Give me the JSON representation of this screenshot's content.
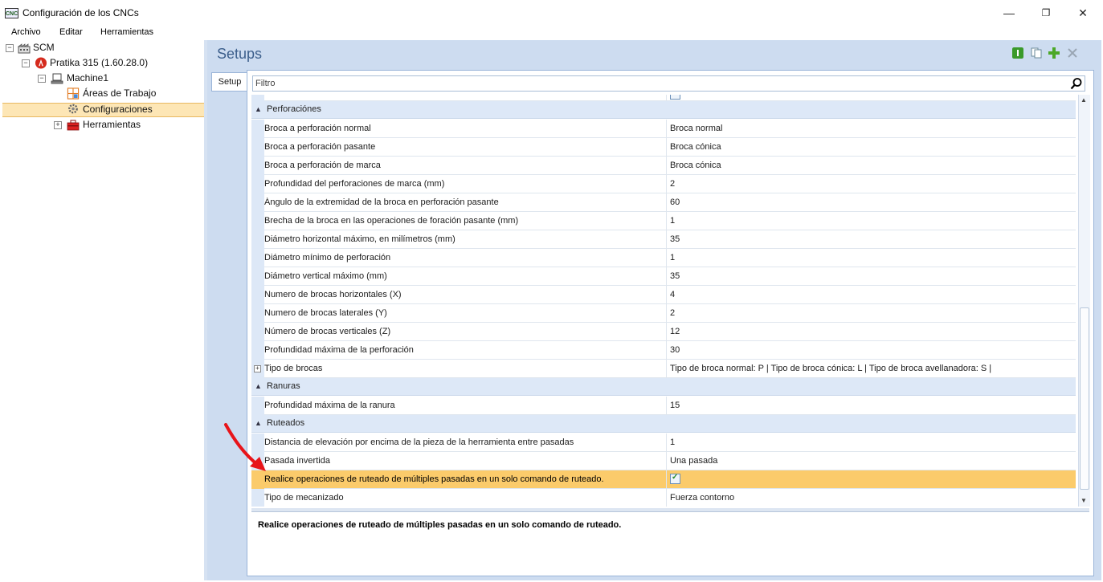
{
  "window": {
    "title": "Configuración de los CNCs",
    "app_icon_text": "CNC",
    "minimize": "—",
    "maximize": "❐",
    "close": "✕"
  },
  "menu": [
    "Archivo",
    "Editar",
    "Herramientas"
  ],
  "tree": {
    "root": "SCM",
    "machine_ver": "Pratika 315 (1.60.28.0)",
    "machine": "Machine1",
    "work_areas": "Áreas de Trabajo",
    "configs": "Configuraciones",
    "tools": "Herramientas"
  },
  "panel": {
    "title": "Setups",
    "tab": "Setup",
    "filter_placeholder": "Filtro"
  },
  "grid": {
    "categories": {
      "perforaciones": "Perforaciónes",
      "ranuras": "Ranuras",
      "ruteados": "Ruteados"
    },
    "perforaciones": [
      {
        "name": "Broca a perforación normal",
        "value": "Broca normal"
      },
      {
        "name": "Broca a perforación pasante",
        "value": "Broca cónica"
      },
      {
        "name": "Broca a perforación de marca",
        "value": "Broca cónica"
      },
      {
        "name": "Profundidad del perforaciones de marca (mm)",
        "value": "2"
      },
      {
        "name": "Ángulo de la extremidad de la broca en perforación pasante",
        "value": "60"
      },
      {
        "name": "Brecha de la broca en las operaciones de foración pasante (mm)",
        "value": "1"
      },
      {
        "name": "Diámetro horizontal máximo, en milímetros (mm)",
        "value": "35"
      },
      {
        "name": "Diámetro mínimo de perforación",
        "value": "1"
      },
      {
        "name": "Diámetro vertical máximo (mm)",
        "value": "35"
      },
      {
        "name": "Numero de brocas horizontales (X)",
        "value": "4"
      },
      {
        "name": "Numero de brocas laterales (Y)",
        "value": "2"
      },
      {
        "name": "Número de brocas verticales (Z)",
        "value": "12"
      },
      {
        "name": "Profundidad máxima de la perforación",
        "value": "30"
      },
      {
        "name": "Tipo de brocas",
        "value": "Tipo de broca normal: P  |  Tipo de broca cónica: L  |  Tipo de broca avellanadora: S  |"
      }
    ],
    "ranuras": [
      {
        "name": "Profundidad máxima de la ranura",
        "value": "15"
      }
    ],
    "ruteados": [
      {
        "name": "Distancia de elevación por encima de la pieza de la herramienta entre pasadas",
        "value": "1"
      },
      {
        "name": "Pasada invertida",
        "value": "Una pasada"
      },
      {
        "name": "Realice operaciones de ruteado de múltiples pasadas en un solo comando de ruteado.",
        "value": ""
      },
      {
        "name": "Tipo de mecanizado",
        "value": "Fuerza contorno"
      }
    ]
  },
  "description": "Realice operaciones de ruteado de múltiples pasadas en un solo comando de ruteado.",
  "colors": {
    "selection": "#fbcb6b",
    "category_bg": "#dde8f7",
    "panel_bg": "#cddcf0",
    "arrow": "#e8141a"
  }
}
